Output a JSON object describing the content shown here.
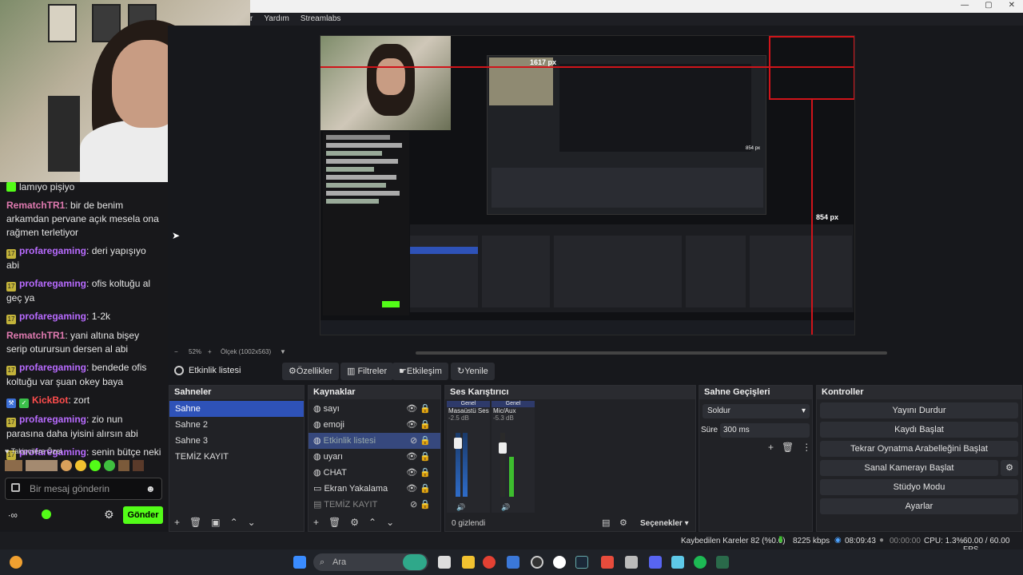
{
  "menu": {
    "items": [
      "Yardım",
      "Streamlabs"
    ]
  },
  "window_controls": {
    "minimize": "—",
    "maximize": "▢",
    "close": "✕"
  },
  "chat": {
    "messages": [
      {
        "user": "",
        "text": "lamıyo pişiyo"
      },
      {
        "user": "RematchTR1",
        "sep": ":",
        "text": " bir de benim arkamdan pervane açık mesela ona rağmen terletiyor"
      },
      {
        "user": "profaregaming",
        "sep": ":",
        "text": " deri yapışıyo abi"
      },
      {
        "user": "profaregaming",
        "sep": ":",
        "text": " ofis koltuğu al geç ya"
      },
      {
        "user": "profaregaming",
        "sep": ":",
        "text": " 1-2k"
      },
      {
        "user": "RematchTR1",
        "sep": ":",
        "text": " yani altına bişey serip oturursun dersen al abi"
      },
      {
        "user": "profaregaming",
        "sep": ":",
        "text": " bendede ofis koltuğu var şuan okey baya"
      },
      {
        "user": "KickBot",
        "sep": ":",
        "text": " zort"
      },
      {
        "user": "profaregaming",
        "sep": ":",
        "text": " zio nun parasına daha iyisini alırsın abi"
      },
      {
        "user": "profaregaming",
        "sep": ":",
        "text": " senin bütçe neki"
      }
    ],
    "followers_label": "Takipçilere Özel",
    "input_placeholder": "Bir mesaj gönderin",
    "send_label": "Gönder"
  },
  "preview": {
    "zoom": "52%",
    "scale": "Ölçek (1002x563)",
    "measure1": "1617 px",
    "measure2": "854 px",
    "measure3": "854 px"
  },
  "toolbar": {
    "source_name": "Etkinlik listesi",
    "properties": "Özellikler",
    "filters": "Filtreler",
    "interact": "Etkileşim",
    "refresh": "Yenile"
  },
  "scenes": {
    "title": "Sahneler",
    "items": [
      "Sahne",
      "Sahne 2",
      "Sahne 3",
      "TEMİZ KAYIT"
    ]
  },
  "sources": {
    "title": "Kaynaklar",
    "items": [
      "sayı",
      "emoji",
      "Etkinlik listesi",
      "uyarı",
      "CHAT",
      "Ekran Yakalama",
      "TEMİZ KAYIT"
    ]
  },
  "mixer": {
    "title": "Ses Karıştırıcı",
    "channels": [
      {
        "group": "Genel",
        "name": "Masaüstü Ses",
        "db": "-2.5 dB"
      },
      {
        "group": "Genel",
        "name": "Mic/Aux",
        "db": "-5.3 dB"
      }
    ],
    "scale": [
      "0",
      "-6",
      "-12",
      "-18",
      "-24",
      "-30",
      "-36",
      "-42",
      "-48",
      "-54",
      "-60"
    ],
    "hidden": "0 gizlendi",
    "options": "Seçenekler"
  },
  "transitions": {
    "title": "Sahne Geçişleri",
    "type": "Soldur",
    "duration_label": "Süre",
    "duration": "300 ms"
  },
  "controls": {
    "title": "Kontroller",
    "buttons": [
      "Yayını Durdur",
      "Kaydı Başlat",
      "Tekrar Oynatma Arabelleğini Başlat",
      "Sanal Kamerayı Başlat",
      "Stüdyo Modu",
      "Ayarlar"
    ]
  },
  "status": {
    "dropped": "Kaybedilen Kareler 82 (%0.0)",
    "bitrate": "8225 kbps",
    "stream_time": "08:09:43",
    "rec_time": "00:00:00",
    "cpu": "CPU: 1.3%",
    "fps": "60.00 / 60.00 FPS"
  },
  "taskbar": {
    "search": "Ara"
  }
}
